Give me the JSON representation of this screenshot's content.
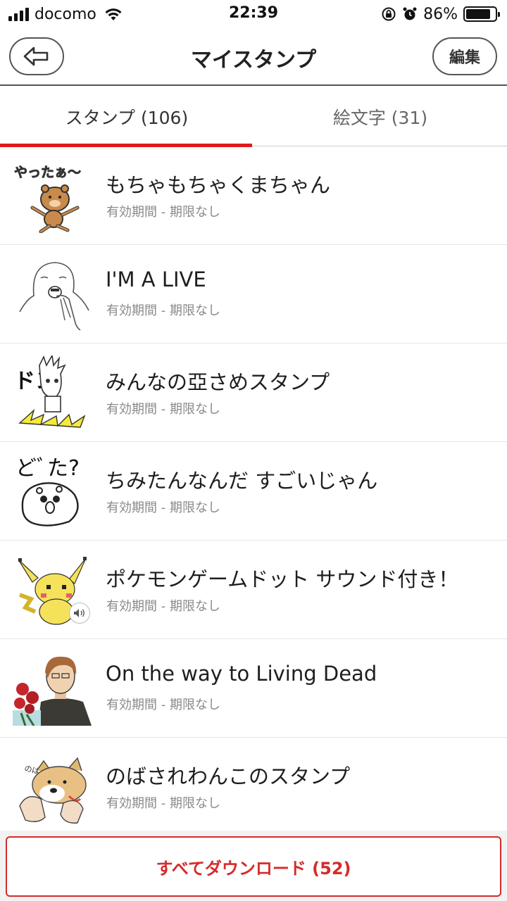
{
  "status_bar": {
    "carrier": "docomo",
    "time": "22:39",
    "battery_percent": "86%",
    "battery_level": 0.86
  },
  "nav": {
    "title": "マイスタンプ",
    "edit_label": "編集",
    "back_icon": "back-arrow-icon"
  },
  "tabs": [
    {
      "label": "スタンプ (106)",
      "active": true
    },
    {
      "label": "絵文字 (31)",
      "active": false
    }
  ],
  "items": [
    {
      "title": "もちゃもちゃくまちゃん",
      "subtitle": "有効期間 - 期限なし",
      "thumb_text": "やったぁ〜"
    },
    {
      "title": "I'M A LIVE",
      "subtitle": "有効期間 - 期限なし"
    },
    {
      "title": "みんなの亞さめスタンプ",
      "subtitle": "有効期間 - 期限なし",
      "thumb_text": "ドン"
    },
    {
      "title": "ちみたんなんだ すごいじゃん",
      "subtitle": "有効期間 - 期限なし",
      "thumb_text": "どﾞた?"
    },
    {
      "title": "ポケモンゲームドット サウンド付き！",
      "subtitle": "有効期間 - 期限なし",
      "has_sound": true
    },
    {
      "title": "On the way to Living Dead",
      "subtitle": "有効期間 - 期限なし"
    },
    {
      "title": "のばされわんこのスタンプ",
      "subtitle": "有効期間 - 期限なし",
      "thumb_text": "のばず"
    }
  ],
  "footer": {
    "download_label": "すべてダウンロード (52)"
  },
  "colors": {
    "accent": "#e0191b",
    "download": "#d52b2b"
  }
}
